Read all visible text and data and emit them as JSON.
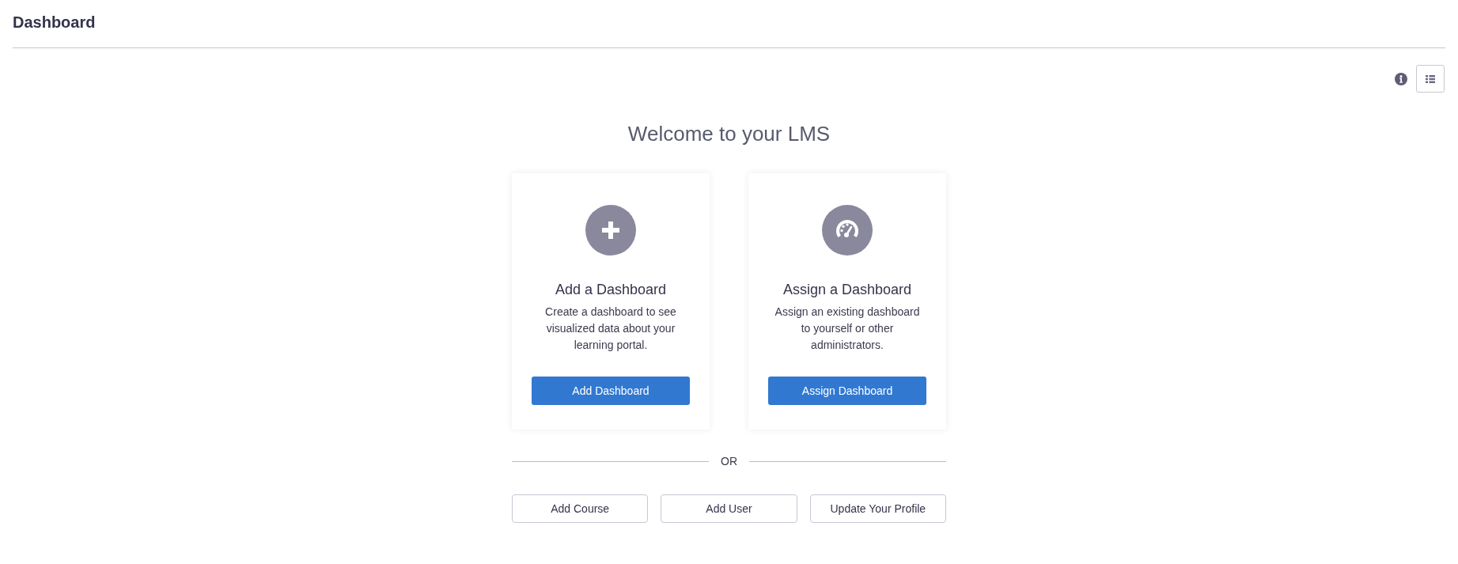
{
  "page": {
    "title": "Dashboard"
  },
  "welcome": {
    "heading": "Welcome to your LMS"
  },
  "cards": [
    {
      "kind": "add",
      "title": "Add a Dashboard",
      "description": "Create a dashboard to see visualized data about your learning portal.",
      "button": "Add Dashboard"
    },
    {
      "kind": "assign",
      "title": "Assign a Dashboard",
      "description": "Assign an existing dashboard to yourself or other administrators.",
      "button": "Assign Dashboard"
    }
  ],
  "divider": {
    "label": "OR"
  },
  "quick_actions": [
    "Add Course",
    "Add User",
    "Update Your Profile"
  ]
}
